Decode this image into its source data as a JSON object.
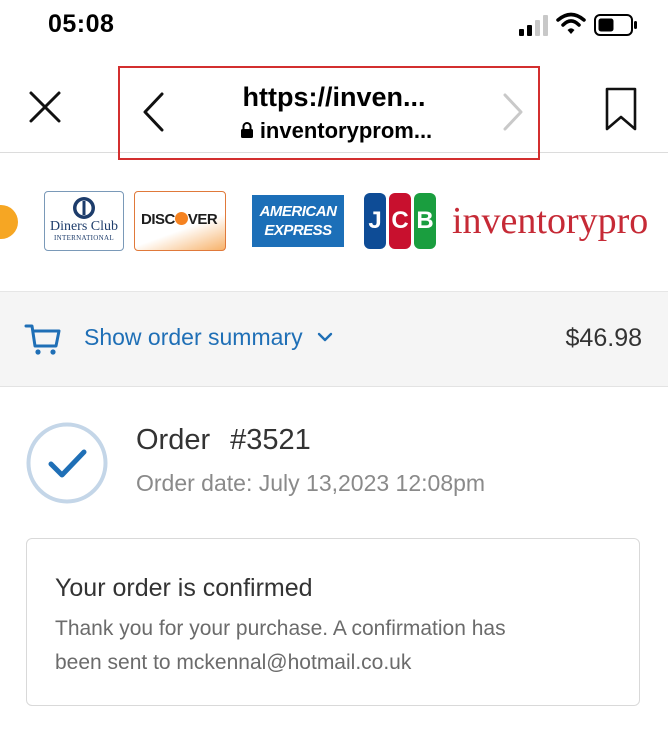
{
  "status_bar": {
    "time": "05:08",
    "icons": [
      "signal-icon",
      "wifi-icon",
      "battery-icon"
    ]
  },
  "browser": {
    "close_icon": "close-icon",
    "back_icon": "chevron-left-icon",
    "forward_icon": "chevron-right-icon",
    "bookmark_icon": "bookmark-icon",
    "page_title": "https://inven...",
    "host": "inventoryprom...",
    "lock_icon": "lock-icon",
    "highlight_color": "#d32f2f"
  },
  "payment_logos": {
    "diners": {
      "line1": "Diners Club",
      "line2": "INTERNATIONAL"
    },
    "discover": {
      "prefix": "DISC",
      "suffix": "VER"
    },
    "amex": {
      "line1": "AMERICAN",
      "line2": "EXPRESS"
    },
    "jcb": {
      "j": "J",
      "c": "C",
      "b": "B"
    },
    "store_name": "inventorypro"
  },
  "summary_bar": {
    "cart_icon": "cart-icon",
    "toggle_label": "Show order summary",
    "chevron_icon": "chevron-down-icon",
    "total": "$46.98",
    "link_color": "#1f6fb6"
  },
  "order": {
    "check_icon": "check-circle-icon",
    "label": "Order",
    "number": "#3521",
    "date_label": "Order date:",
    "date_value": "July 13,2023 12:08pm"
  },
  "confirmation": {
    "heading": "Your order is confirmed",
    "body_line1": "Thank you for your purchase. A confirmation has",
    "body_line2": "been sent to mckennal@hotmail.co.uk"
  }
}
